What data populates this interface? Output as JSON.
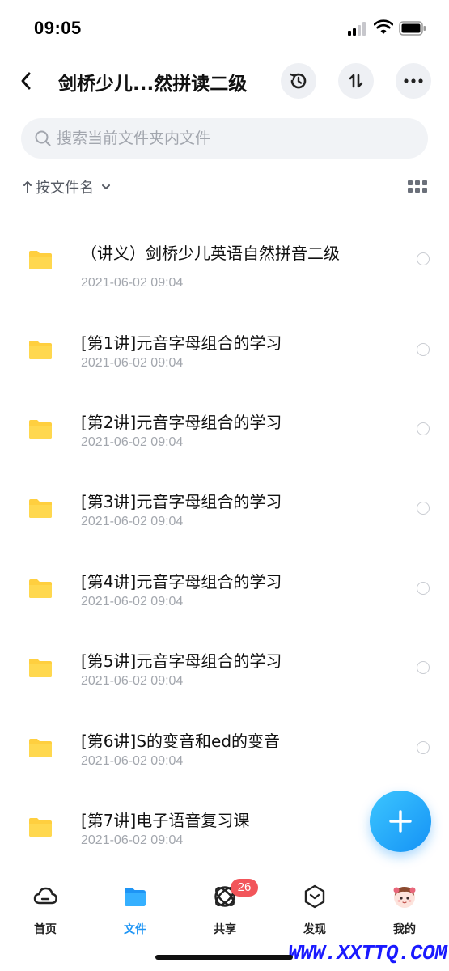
{
  "status_bar": {
    "time": "09:05"
  },
  "header": {
    "title": "剑桥少儿...然拼读二级"
  },
  "search": {
    "placeholder": "搜索当前文件夹内文件"
  },
  "sort": {
    "label": "按文件名"
  },
  "files": [
    {
      "name": "（讲义）剑桥少儿英语自然拼音二级",
      "date": "2021-06-02 09:04"
    },
    {
      "name": "[第1讲]元音字母组合的学习",
      "date": "2021-06-02 09:04"
    },
    {
      "name": "[第2讲]元音字母组合的学习",
      "date": "2021-06-02 09:04"
    },
    {
      "name": "[第3讲]元音字母组合的学习",
      "date": "2021-06-02 09:04"
    },
    {
      "name": "[第4讲]元音字母组合的学习",
      "date": "2021-06-02 09:04"
    },
    {
      "name": "[第5讲]元音字母组合的学习",
      "date": "2021-06-02 09:04"
    },
    {
      "name": "[第6讲]S的变音和ed的变音",
      "date": "2021-06-02 09:04"
    },
    {
      "name": "[第7讲]电子语音复习课",
      "date": "2021-06-02 09:04"
    }
  ],
  "tabs": [
    {
      "label": "首页",
      "icon": "cloud-icon"
    },
    {
      "label": "文件",
      "icon": "folder-icon"
    },
    {
      "label": "共享",
      "icon": "share-atom-icon",
      "badge": "26"
    },
    {
      "label": "发现",
      "icon": "discover-icon"
    },
    {
      "label": "我的",
      "icon": "avatar-icon"
    }
  ],
  "watermark": "WWW.XXTTQ.COM",
  "colors": {
    "accent": "#1e95f5",
    "folder": "#ffcf3f",
    "badge": "#f2555a"
  }
}
